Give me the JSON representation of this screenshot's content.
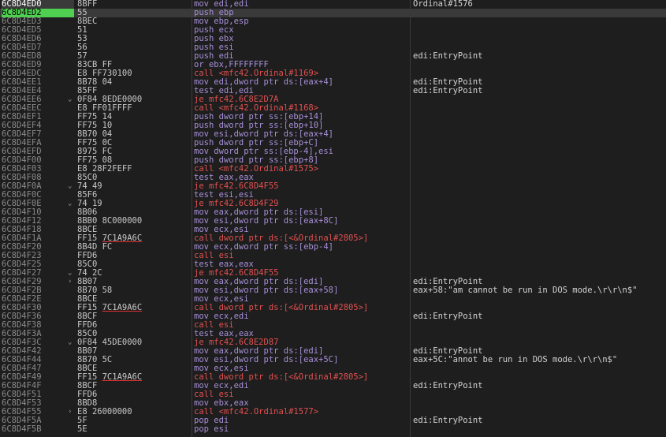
{
  "rows": [
    {
      "addr": "6C8D4ED0",
      "jmp": "",
      "bytes": "8BFF",
      "instr": "mov edi,edi",
      "kind": "mov",
      "comment": "Ordinal#1576",
      "addr_style": "hl"
    },
    {
      "addr": "6C8D4ED2",
      "jmp": "",
      "bytes": "55",
      "instr": "push ebp",
      "kind": "push",
      "comment": "",
      "addr_style": "eip",
      "selected": true
    },
    {
      "addr": "6C8D4ED3",
      "jmp": "",
      "bytes": "8BEC",
      "instr": "mov ebp,esp",
      "kind": "push",
      "comment": ""
    },
    {
      "addr": "6C8D4ED5",
      "jmp": "",
      "bytes": "51",
      "instr": "push ecx",
      "kind": "push",
      "comment": ""
    },
    {
      "addr": "6C8D4ED6",
      "jmp": "",
      "bytes": "53",
      "instr": "push ebx",
      "kind": "push",
      "comment": ""
    },
    {
      "addr": "6C8D4ED7",
      "jmp": "",
      "bytes": "56",
      "instr": "push esi",
      "kind": "push",
      "comment": ""
    },
    {
      "addr": "6C8D4ED8",
      "jmp": "",
      "bytes": "57",
      "instr": "push edi",
      "kind": "push",
      "comment": "edi:EntryPoint"
    },
    {
      "addr": "6C8D4ED9",
      "jmp": "",
      "bytes": "83CB FF",
      "instr": "or ebx,FFFFFFFF",
      "kind": "push",
      "comment": ""
    },
    {
      "addr": "6C8D4EDC",
      "jmp": "",
      "bytes": "E8 FF730100",
      "instr": "call <mfc42.Ordinal#1169>",
      "kind": "call",
      "comment": ""
    },
    {
      "addr": "6C8D4EE1",
      "jmp": "",
      "bytes": "8B78 04",
      "instr": "mov edi,dword ptr ds:[eax+4]",
      "kind": "push",
      "comment": "edi:EntryPoint"
    },
    {
      "addr": "6C8D4EE4",
      "jmp": "",
      "bytes": "85FF",
      "instr": "test edi,edi",
      "kind": "push",
      "comment": "edi:EntryPoint"
    },
    {
      "addr": "6C8D4EE6",
      "jmp": "v",
      "bytes": "0F84 8EDE0000",
      "instr": "je mfc42.6C8E2D7A",
      "kind": "call",
      "comment": ""
    },
    {
      "addr": "6C8D4EEC",
      "jmp": "",
      "bytes": "E8 FF01FFFF",
      "instr": "call <mfc42.Ordinal#1168>",
      "kind": "call",
      "comment": ""
    },
    {
      "addr": "6C8D4EF1",
      "jmp": "",
      "bytes": "FF75 14",
      "instr": "push dword ptr ss:[ebp+14]",
      "kind": "push",
      "comment": ""
    },
    {
      "addr": "6C8D4EF4",
      "jmp": "",
      "bytes": "FF75 10",
      "instr": "push dword ptr ss:[ebp+10]",
      "kind": "push",
      "comment": ""
    },
    {
      "addr": "6C8D4EF7",
      "jmp": "",
      "bytes": "8B70 04",
      "instr": "mov esi,dword ptr ds:[eax+4]",
      "kind": "push",
      "comment": ""
    },
    {
      "addr": "6C8D4EFA",
      "jmp": "",
      "bytes": "FF75 0C",
      "instr": "push dword ptr ss:[ebp+C]",
      "kind": "push",
      "comment": ""
    },
    {
      "addr": "6C8D4EFD",
      "jmp": "",
      "bytes": "8975 FC",
      "instr": "mov dword ptr ss:[ebp-4],esi",
      "kind": "push",
      "comment": ""
    },
    {
      "addr": "6C8D4F00",
      "jmp": "",
      "bytes": "FF75 08",
      "instr": "push dword ptr ss:[ebp+8]",
      "kind": "push",
      "comment": ""
    },
    {
      "addr": "6C8D4F03",
      "jmp": "",
      "bytes": "E8 28F2FEFF",
      "instr": "call <mfc42.Ordinal#1575>",
      "kind": "call",
      "comment": ""
    },
    {
      "addr": "6C8D4F08",
      "jmp": "",
      "bytes": "85C0",
      "instr": "test eax,eax",
      "kind": "push",
      "comment": ""
    },
    {
      "addr": "6C8D4F0A",
      "jmp": "v",
      "bytes": "74 49",
      "instr": "je mfc42.6C8D4F55",
      "kind": "call",
      "comment": ""
    },
    {
      "addr": "6C8D4F0C",
      "jmp": "",
      "bytes": "85F6",
      "instr": "test esi,esi",
      "kind": "push",
      "comment": ""
    },
    {
      "addr": "6C8D4F0E",
      "jmp": "v",
      "bytes": "74 19",
      "instr": "je mfc42.6C8D4F29",
      "kind": "call",
      "comment": ""
    },
    {
      "addr": "6C8D4F10",
      "jmp": "",
      "bytes": "8B06",
      "instr": "mov eax,dword ptr ds:[esi]",
      "kind": "push",
      "comment": ""
    },
    {
      "addr": "6C8D4F12",
      "jmp": "",
      "bytes": "8BB0 8C000000",
      "instr": "mov esi,dword ptr ds:[eax+8C]",
      "kind": "push",
      "comment": ""
    },
    {
      "addr": "6C8D4F18",
      "jmp": "",
      "bytes": "8BCE",
      "instr": "mov ecx,esi",
      "kind": "push",
      "comment": ""
    },
    {
      "addr": "6C8D4F1A",
      "jmp": "",
      "bytes": "FF15 7C1A9A6C",
      "ref": "7C1A9A6C",
      "instr": "call dword ptr ds:[<&Ordinal#2805>]",
      "kind": "call",
      "comment": ""
    },
    {
      "addr": "6C8D4F20",
      "jmp": "",
      "bytes": "8B4D FC",
      "instr": "mov ecx,dword ptr ss:[ebp-4]",
      "kind": "push",
      "comment": ""
    },
    {
      "addr": "6C8D4F23",
      "jmp": "",
      "bytes": "FFD6",
      "instr": "call esi",
      "kind": "call",
      "comment": ""
    },
    {
      "addr": "6C8D4F25",
      "jmp": "",
      "bytes": "85C0",
      "instr": "test eax,eax",
      "kind": "push",
      "comment": ""
    },
    {
      "addr": "6C8D4F27",
      "jmp": "v",
      "bytes": "74 2C",
      "instr": "je mfc42.6C8D4F55",
      "kind": "call",
      "comment": ""
    },
    {
      "addr": "6C8D4F29",
      "jmp": ">",
      "bytes": "8B07",
      "instr": "mov eax,dword ptr ds:[edi]",
      "kind": "push",
      "comment": "edi:EntryPoint"
    },
    {
      "addr": "6C8D4F2B",
      "jmp": "",
      "bytes": "8B70 58",
      "instr": "mov esi,dword ptr ds:[eax+58]",
      "kind": "push",
      "comment": "eax+58:\"am cannot be run in DOS mode.\\r\\r\\n$\""
    },
    {
      "addr": "6C8D4F2E",
      "jmp": "",
      "bytes": "8BCE",
      "instr": "mov ecx,esi",
      "kind": "push",
      "comment": ""
    },
    {
      "addr": "6C8D4F30",
      "jmp": "",
      "bytes": "FF15 7C1A9A6C",
      "ref": "7C1A9A6C",
      "instr": "call dword ptr ds:[<&Ordinal#2805>]",
      "kind": "call",
      "comment": ""
    },
    {
      "addr": "6C8D4F36",
      "jmp": "",
      "bytes": "8BCF",
      "instr": "mov ecx,edi",
      "kind": "push",
      "comment": "edi:EntryPoint"
    },
    {
      "addr": "6C8D4F38",
      "jmp": "",
      "bytes": "FFD6",
      "instr": "call esi",
      "kind": "call",
      "comment": ""
    },
    {
      "addr": "6C8D4F3A",
      "jmp": "",
      "bytes": "85C0",
      "instr": "test eax,eax",
      "kind": "push",
      "comment": ""
    },
    {
      "addr": "6C8D4F3C",
      "jmp": "v",
      "bytes": "0F84 45DE0000",
      "instr": "je mfc42.6C8E2D87",
      "kind": "call",
      "comment": ""
    },
    {
      "addr": "6C8D4F42",
      "jmp": "",
      "bytes": "8B07",
      "instr": "mov eax,dword ptr ds:[edi]",
      "kind": "push",
      "comment": "edi:EntryPoint"
    },
    {
      "addr": "6C8D4F44",
      "jmp": "",
      "bytes": "8B70 5C",
      "instr": "mov esi,dword ptr ds:[eax+5C]",
      "kind": "push",
      "comment": "eax+5C:\"annot be run in DOS mode.\\r\\r\\n$\""
    },
    {
      "addr": "6C8D4F47",
      "jmp": "",
      "bytes": "8BCE",
      "instr": "mov ecx,esi",
      "kind": "push",
      "comment": ""
    },
    {
      "addr": "6C8D4F49",
      "jmp": "",
      "bytes": "FF15 7C1A9A6C",
      "ref": "7C1A9A6C",
      "instr": "call dword ptr ds:[<&Ordinal#2805>]",
      "kind": "call",
      "comment": ""
    },
    {
      "addr": "6C8D4F4F",
      "jmp": "",
      "bytes": "8BCF",
      "instr": "mov ecx,edi",
      "kind": "push",
      "comment": "edi:EntryPoint"
    },
    {
      "addr": "6C8D4F51",
      "jmp": "",
      "bytes": "FFD6",
      "instr": "call esi",
      "kind": "call",
      "comment": ""
    },
    {
      "addr": "6C8D4F53",
      "jmp": "",
      "bytes": "8BD8",
      "instr": "mov ebx,eax",
      "kind": "push",
      "comment": ""
    },
    {
      "addr": "6C8D4F55",
      "jmp": ">",
      "bytes": "E8 26000000",
      "instr": "call <mfc42.Ordinal#1577>",
      "kind": "call",
      "comment": ""
    },
    {
      "addr": "6C8D4F5A",
      "jmp": "",
      "bytes": "5F",
      "instr": "pop edi",
      "kind": "push",
      "comment": "edi:EntryPoint"
    },
    {
      "addr": "6C8D4F5B",
      "jmp": "",
      "bytes": "5E",
      "instr": "pop esi",
      "kind": "push",
      "comment": ""
    }
  ],
  "colors": {
    "background": "#1e1e1e",
    "eip_highlight": "#4fd050",
    "instruction": "#a78fd8",
    "call_jump": "#e05050"
  }
}
